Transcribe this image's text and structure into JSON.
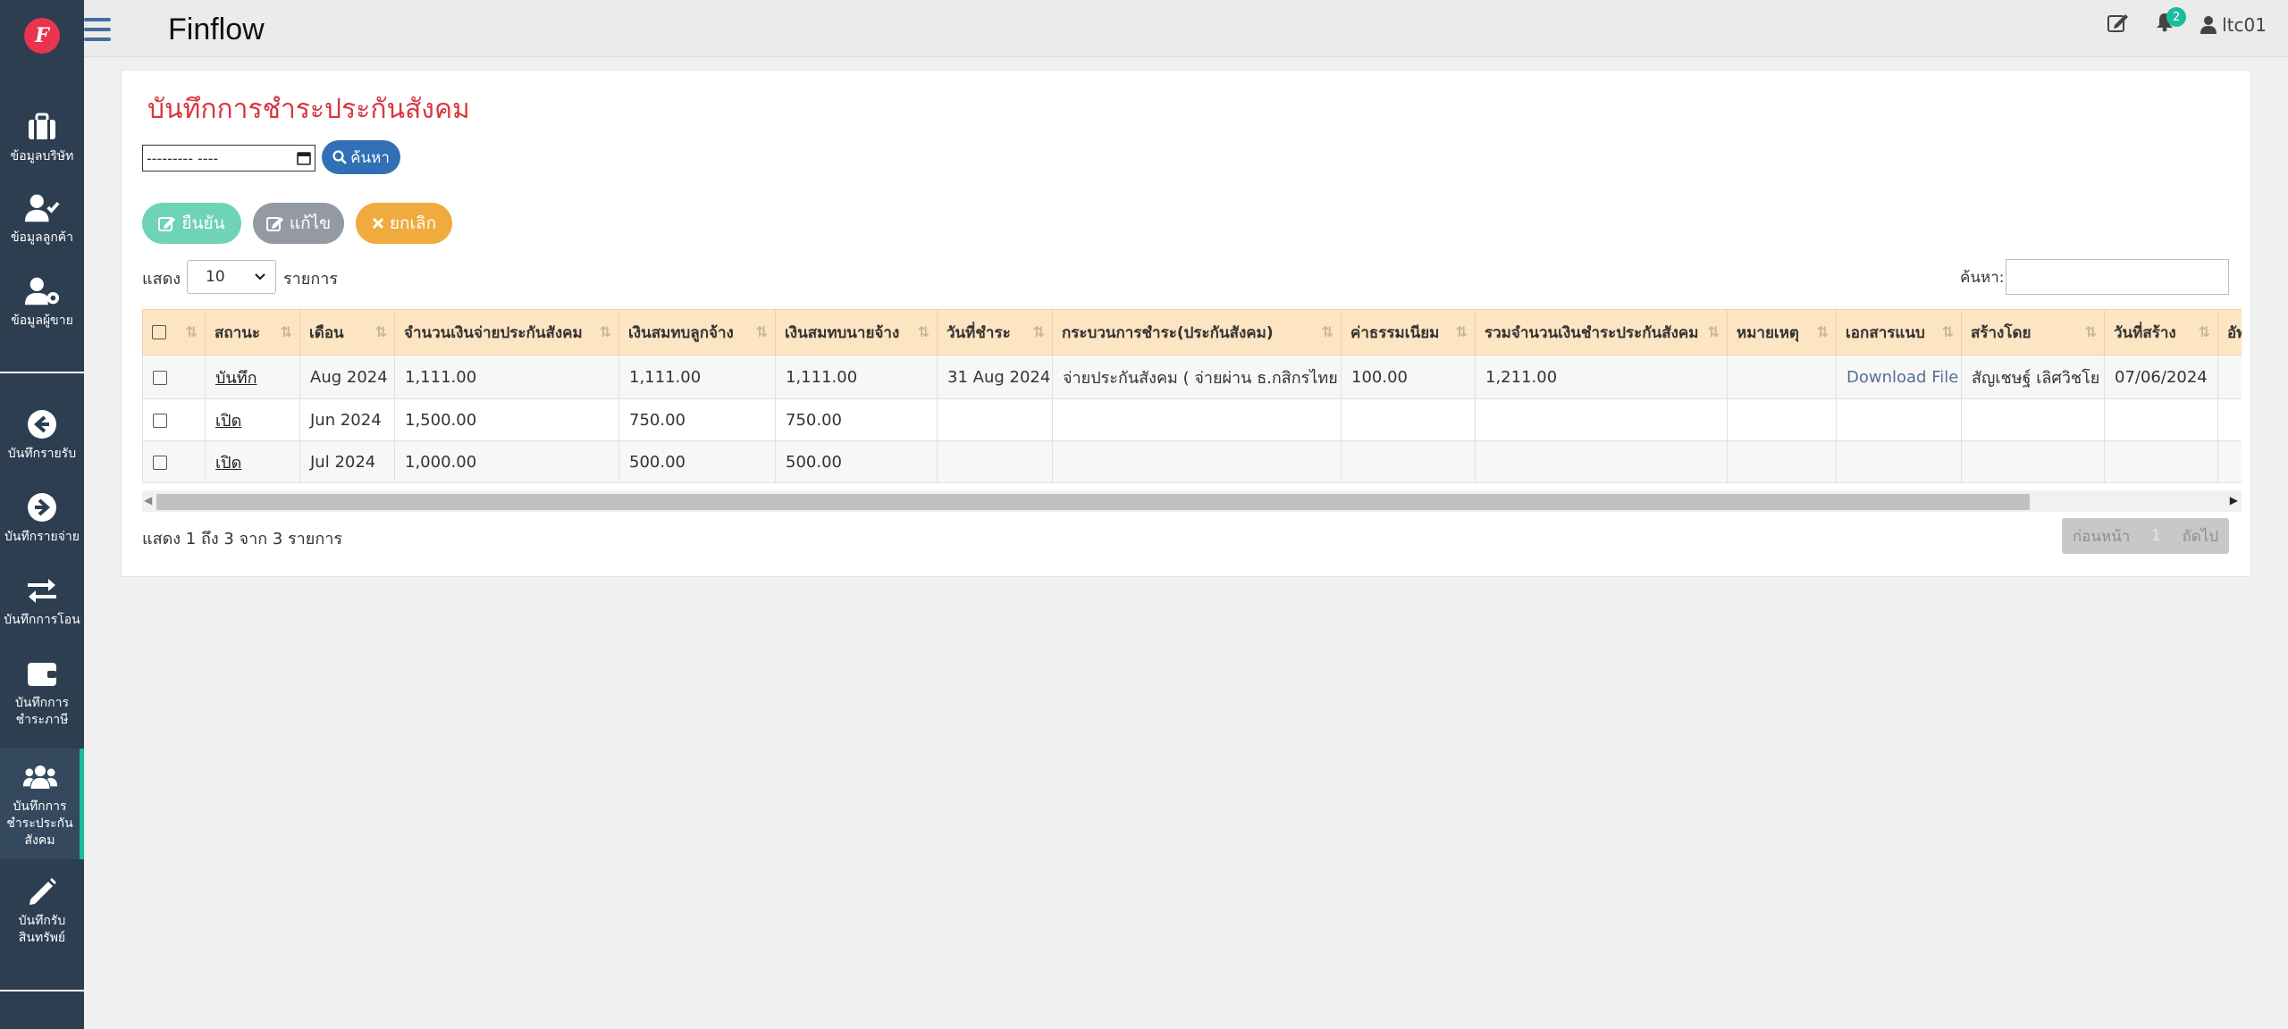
{
  "app": {
    "logo_letter": "F",
    "title": "Finflow"
  },
  "sidebar": {
    "items": [
      {
        "label": "ข้อมูลบริษัท",
        "icon": "briefcase-icon"
      },
      {
        "label": "ข้อมูลลูกค้า",
        "icon": "user-check-icon"
      },
      {
        "label": "ข้อมูลผู้ขาย",
        "icon": "user-gear-icon"
      },
      {
        "label": "บันทึกรายรับ",
        "icon": "arrow-left-circle-icon"
      },
      {
        "label": "บันทึกรายจ่าย",
        "icon": "arrow-right-circle-icon"
      },
      {
        "label": "บันทึกการโอน",
        "icon": "exchange-icon"
      },
      {
        "label": "บันทึกการชำระภาษี",
        "icon": "wallet-icon"
      },
      {
        "label": "บันทึกการชำระประกันสังคม",
        "icon": "users-icon",
        "active": true
      },
      {
        "label": "บันทึกรับสินทรัพย์",
        "icon": "pencil-icon"
      }
    ]
  },
  "topbar": {
    "notifications_count": "2",
    "username": "ltc01"
  },
  "page": {
    "title": "บันทึกการชำระประกันสังคม",
    "date_value": "--------- ----",
    "search_label": "ค้นหา",
    "confirm_label": "ยืนยัน",
    "edit_label": "แก้ไข",
    "cancel_label": "ยกเลิก",
    "show_label": "แสดง",
    "page_length": "10",
    "entries_label": "รายการ",
    "filter_label": "ค้นหา:",
    "filter_value": ""
  },
  "table": {
    "columns": [
      "สถานะ",
      "เดือน",
      "จำนวนเงินจ่ายประกันสังคม",
      "เงินสมทบลูกจ้าง",
      "เงินสมทบนายจ้าง",
      "วันที่ชำระ",
      "กระบวนการชำระ(ประกันสังคม)",
      "ค่าธรรมเนียม",
      "รวมจำนวนเงินชำระประกันสังคม",
      "หมายเหตุ",
      "เอกสารแนบ",
      "สร้างโดย",
      "วันที่สร้าง",
      "อัพ"
    ],
    "rows": [
      {
        "status": "บันทึก",
        "month": "Aug 2024",
        "amount": "1,111.00",
        "employee": "1,111.00",
        "employer": "1,111.00",
        "pay_date": "31 Aug 2024",
        "process": "จ่ายประกันสังคม ( จ่ายผ่าน ธ.กสิกรไทย )",
        "fee": "100.00",
        "total": "1,211.00",
        "note": "",
        "attachment": "Download File",
        "created_by": "สัญเชษฐ์ เลิศวิชโย",
        "created_date": "07/06/2024",
        "updated": ""
      },
      {
        "status": "เปิด",
        "month": "Jun 2024",
        "amount": "1,500.00",
        "employee": "750.00",
        "employer": "750.00",
        "pay_date": "",
        "process": "",
        "fee": "",
        "total": "",
        "note": "",
        "attachment": "",
        "created_by": "",
        "created_date": "",
        "updated": ""
      },
      {
        "status": "เปิด",
        "month": "Jul 2024",
        "amount": "1,000.00",
        "employee": "500.00",
        "employer": "500.00",
        "pay_date": "",
        "process": "",
        "fee": "",
        "total": "",
        "note": "",
        "attachment": "",
        "created_by": "",
        "created_date": "",
        "updated": ""
      }
    ]
  },
  "footer": {
    "info": "แสดง 1 ถึง 3 จาก 3 รายการ",
    "prev_label": "ก่อนหน้า",
    "current_page": "1",
    "next_label": "ถัดไป"
  },
  "colors": {
    "accent": "#d9363e",
    "sidebar": "#2c3e50",
    "active_marker": "#1abc9c",
    "header_bg": "#fde4c2"
  }
}
